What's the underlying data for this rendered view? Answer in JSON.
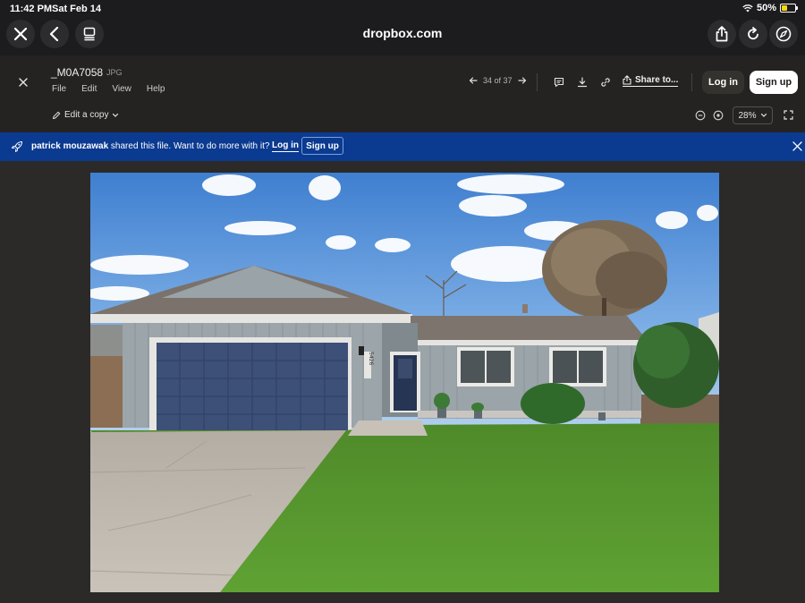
{
  "status_bar": {
    "time": "11:42 PM",
    "date": "Sat Feb 14",
    "battery": "50%"
  },
  "browser": {
    "url": "dropbox.com"
  },
  "file": {
    "name": "_M0A7058",
    "ext": "JPG"
  },
  "menu": [
    "File",
    "Edit",
    "View",
    "Help"
  ],
  "edit_copy_label": "Edit a copy",
  "pager": "34 of 37",
  "share_label": "Share to...",
  "auth": {
    "login": "Log in",
    "signup": "Sign up"
  },
  "zoom": "28%",
  "banner": {
    "owner": "patrick mouzawak",
    "message": " shared this file. Want to do more with it?",
    "login": "Log in",
    "signup": "Sign up"
  },
  "house_number": "5426",
  "colors": {
    "banner_bg": "#0b3a91",
    "header_bg": "#242322",
    "canvas_bg": "#2b2a29"
  }
}
